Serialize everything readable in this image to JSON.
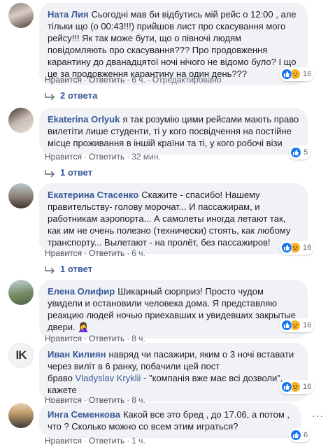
{
  "comments": [
    {
      "author": "Ната Лия",
      "text": "Сьогодні мав би відбутись мій рейс о 12:00 , але тільки що (о 00:43!!!) прийшов лист про скасування мого рейсу!!! Як так може бути, що о півночі людям повідомляють про скасування??? Про продовження карантину до дванадцятої ночі нічого не відомо було? І що це за продовження карантину на один день???",
      "like": "Нравится",
      "reply": "Ответить",
      "time": "6 ч.",
      "edited": "Отредактировано",
      "reactions": "16",
      "replies": "2 ответа"
    },
    {
      "author": "Ekaterina Orlyuk",
      "text": "я так розумію цими рейсами мають право вилетіти лише студенти, ті у кого посвідчення на постійне місце проживання в іншій країни та ті, у кого робочі візи",
      "like": "Нравится",
      "reply": "Ответить",
      "time": "32 мин.",
      "reactions": "5",
      "replies": "1 ответ"
    },
    {
      "author": "Екатерина Стасенко",
      "text": "Скажите - спасибо! Нашему правительству- голову морочат... И пассажирам, и работникам аэропорта... А самолеты иногда летают так, как им не очень полезно (технически) стоять, как любому транспорту... Вылетают - на пролёт, без пассажиров!",
      "like": "Нравится",
      "reply": "Ответить",
      "time": "6 ч.",
      "reactions": "16",
      "replies": "1 ответ"
    },
    {
      "author": "Елена Олифир",
      "text": "Шикарный сюрприз! Просто чудом увидели и остановили человека дома. Я представляю реакцию людей ночью приехавших и увидевших закрытые двери. 🤦‍♀️",
      "like": "Нравится",
      "reply": "Ответить",
      "time": "8 ч.",
      "reactions": "16"
    },
    {
      "author": "Иван Килиян",
      "text": "навряд чи пасажири, яким о 3 ночі вставати через виліт в 6 ранку, побачили цей пост",
      "text2_pre": "браво ",
      "text2_link": "Vladyslav Kryklii",
      "text2_post": " - \"компанія вже має всі дозволи\", кажете",
      "avatar_text": "IK",
      "like": "Нравится",
      "reply": "Ответить",
      "time": "8 ч.",
      "reactions": "16"
    },
    {
      "author": "Инга Семенкова",
      "text": "Какой все это бред , до 17.06, а потом , что ? Сколько можно со всем этим играться?",
      "like": "Нравится",
      "reply": "Ответить",
      "time": "1 ч.",
      "reactions": "6"
    }
  ],
  "menu_icon": "more-dots-icon",
  "reaction_icons": [
    "like-icon",
    "sad-icon"
  ]
}
